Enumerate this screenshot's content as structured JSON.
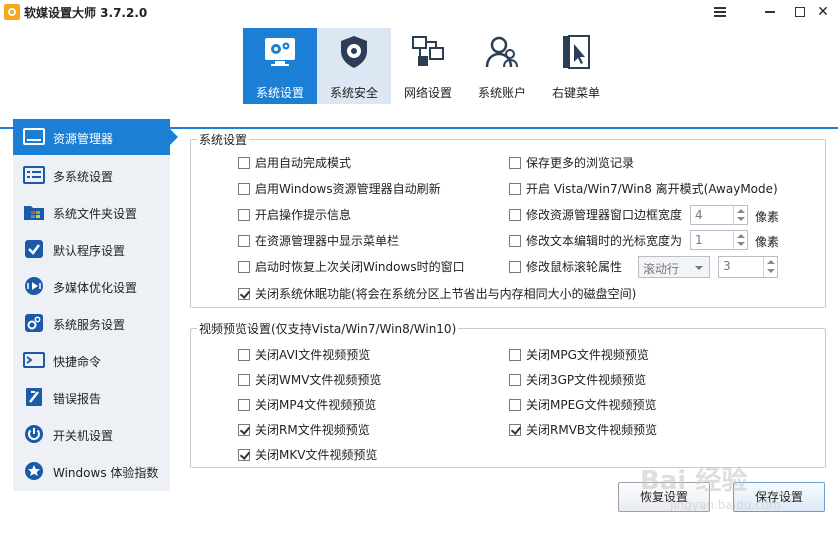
{
  "window": {
    "title": "软媒设置大师 3.7.2.0"
  },
  "top_tabs": [
    {
      "label": "系统设置",
      "icon": "gear-monitor-icon",
      "active": true
    },
    {
      "label": "系统安全",
      "icon": "shield-gear-icon",
      "active": false
    },
    {
      "label": "网络设置",
      "icon": "network-icon",
      "active": false
    },
    {
      "label": "系统账户",
      "icon": "users-icon",
      "active": false
    },
    {
      "label": "右键菜单",
      "icon": "context-menu-icon",
      "active": false
    }
  ],
  "sidebar": {
    "items": [
      {
        "label": "资源管理器",
        "icon": "explorer-icon",
        "active": true
      },
      {
        "label": "多系统设置",
        "icon": "multi-system-icon"
      },
      {
        "label": "系统文件夹设置",
        "icon": "windows-folder-icon"
      },
      {
        "label": "默认程序设置",
        "icon": "default-program-icon"
      },
      {
        "label": "多媒体优化设置",
        "icon": "multimedia-icon"
      },
      {
        "label": "系统服务设置",
        "icon": "services-icon"
      },
      {
        "label": "快捷命令",
        "icon": "shortcut-command-icon"
      },
      {
        "label": "错误报告",
        "icon": "error-report-icon"
      },
      {
        "label": "开关机设置",
        "icon": "power-icon"
      },
      {
        "label": "Windows 体验指数",
        "icon": "experience-index-icon"
      }
    ]
  },
  "system_settings": {
    "title": "系统设置",
    "left_options": [
      {
        "label": "启用自动完成模式",
        "checked": false
      },
      {
        "label": "启用Windows资源管理器自动刷新",
        "checked": false
      },
      {
        "label": "开启操作提示信息",
        "checked": false
      },
      {
        "label": "在资源管理器中显示菜单栏",
        "checked": false
      },
      {
        "label": "启动时恢复上次关闭Windows时的窗口",
        "checked": false
      }
    ],
    "right_options": [
      {
        "label": "保存更多的浏览记录",
        "checked": false
      },
      {
        "label": "开启 Vista/Win7/Win8 离开模式(AwayMode)",
        "checked": false
      },
      {
        "label": "修改资源管理器窗口边框宽度",
        "checked": false
      },
      {
        "label": "修改文本编辑时的光标宽度为",
        "checked": false
      },
      {
        "label": "修改鼠标滚轮属性",
        "checked": false
      }
    ],
    "border_width": {
      "value": "4",
      "unit": "像素"
    },
    "cursor_width": {
      "value": "1",
      "unit": "像素"
    },
    "wheel_mode": {
      "value": "滚动行"
    },
    "wheel_lines": {
      "value": "3"
    },
    "hibernate": {
      "label": "关闭系统休眠功能(将会在系统分区上节省出与内存相同大小的磁盘空间)",
      "checked": true
    }
  },
  "video_preview": {
    "title": "视频预览设置(仅支持Vista/Win7/Win8/Win10)",
    "left_options": [
      {
        "label": "关闭AVI文件视频预览",
        "checked": false
      },
      {
        "label": "关闭WMV文件视频预览",
        "checked": false
      },
      {
        "label": "关闭MP4文件视频预览",
        "checked": false
      },
      {
        "label": "关闭RM文件视频预览",
        "checked": true
      },
      {
        "label": "关闭MKV文件视频预览",
        "checked": true
      }
    ],
    "right_options": [
      {
        "label": "关闭MPG文件视频预览",
        "checked": false
      },
      {
        "label": "关闭3GP文件视频预览",
        "checked": false
      },
      {
        "label": "关闭MPEG文件视频预览",
        "checked": false
      },
      {
        "label": "关闭RMVB文件视频预览",
        "checked": true
      }
    ]
  },
  "buttons": {
    "restore": "恢复设置",
    "save": "保存设置"
  },
  "watermark": {
    "text": "Bai 经验",
    "url": "jingyan.baidu.com"
  },
  "colors": {
    "accent": "#1b7fd6",
    "sidebar_bg": "#edf1f6"
  }
}
